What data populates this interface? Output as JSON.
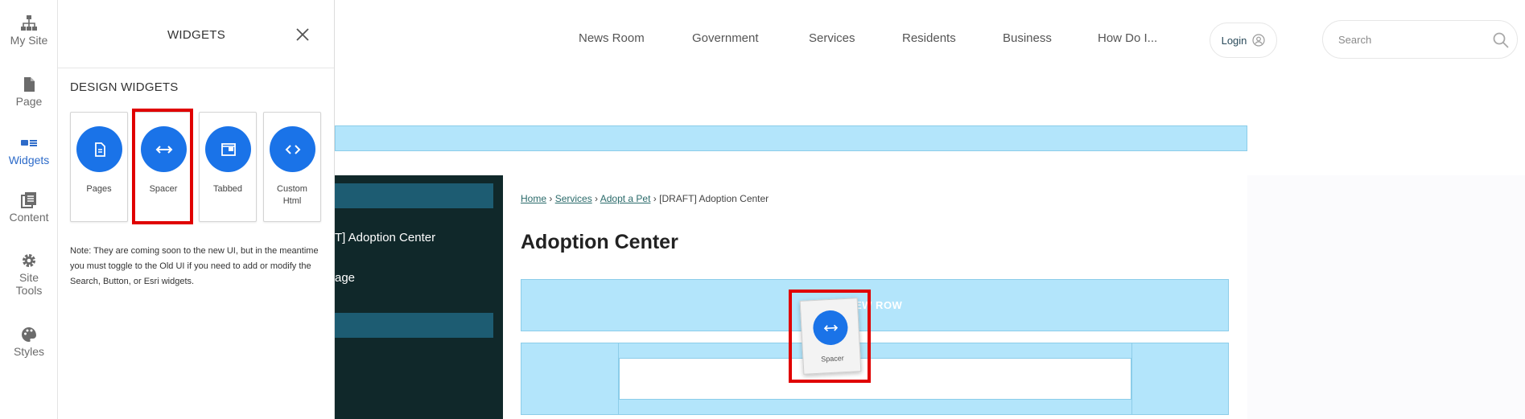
{
  "rail": {
    "items": [
      {
        "label": "My Site",
        "icon": "sitemap-icon"
      },
      {
        "label": "Page",
        "icon": "page-icon"
      },
      {
        "label": "Widgets",
        "icon": "widgets-icon"
      },
      {
        "label": "Content",
        "icon": "content-icon"
      },
      {
        "label": "Site Tools",
        "icon": "gear-icon"
      },
      {
        "label": "Styles",
        "icon": "palette-icon"
      }
    ],
    "active": "Widgets"
  },
  "panel": {
    "title": "WIDGETS",
    "section_title": "DESIGN WIDGETS",
    "widgets": [
      {
        "label": "Pages",
        "icon": "document-icon"
      },
      {
        "label": "Spacer",
        "icon": "horizontal-arrows-icon"
      },
      {
        "label": "Tabbed",
        "icon": "tabbed-window-icon"
      },
      {
        "label": "Custom Html",
        "icon": "code-brackets-icon"
      }
    ],
    "highlighted_widget": "Spacer",
    "note": "Note: They are coming soon to the new UI, but in the meantime you must toggle to the Old UI if you need to add or modify the Search, Button, or Esri widgets."
  },
  "nav": {
    "items": [
      "News Room",
      "Government",
      "Services",
      "Residents",
      "Business",
      "How Do I..."
    ],
    "login_label": "Login",
    "search_placeholder": "Search"
  },
  "page": {
    "breadcrumb": {
      "home": "Home",
      "sep": " › ",
      "services": " Services",
      "adopt": " Adopt a Pet",
      "current": "[DRAFT] Adoption Center"
    },
    "sidebar_text_1": "T] Adoption Center",
    "sidebar_text_2": "age",
    "title": "Adoption Center",
    "row_label": "EW ROW",
    "ghost_label": "Spacer"
  },
  "colors": {
    "accent": "#1a73e8",
    "highlight": "#e00000",
    "drop_zone": "#b3e5fb",
    "dark_panel": "#10282a",
    "dark_bar": "#1d5c72",
    "rail_active": "#2d6bc9"
  }
}
